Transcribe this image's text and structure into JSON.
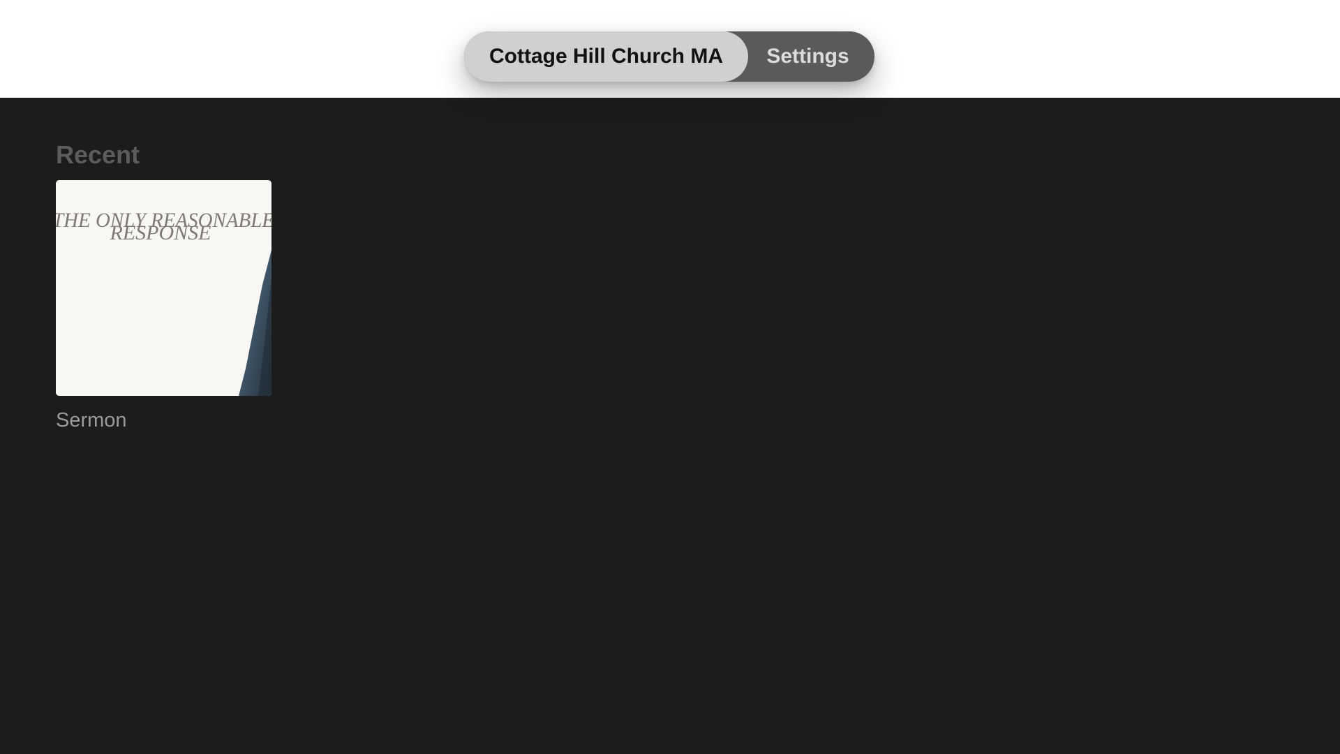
{
  "tabs": {
    "home_label": "Cottage Hill Church MA",
    "settings_label": "Settings"
  },
  "recent": {
    "title": "Recent",
    "items": [
      {
        "caption": "Sermon",
        "artwork_line1": "THE ONLY REASONABLE",
        "artwork_line2": "RESPONSE"
      }
    ]
  },
  "colors": {
    "background": "#1c1c1c",
    "tab_selected": "#d0d0d2",
    "tab_bar": "#5a5a5a",
    "artwork_bg": "#f9f7f3",
    "artwork_accent": "#3e5466"
  }
}
